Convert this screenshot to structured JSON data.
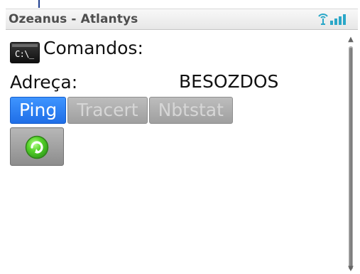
{
  "window": {
    "title": "Ozeanus - Atlantys"
  },
  "status": {
    "signal_icon": "signal-strength-icon"
  },
  "content": {
    "commands_icon": "terminal-icon",
    "commands_icon_text": "C:\\_",
    "commands_label": "Comandos:",
    "address_label": "Adreça:",
    "address_value": "BESOZDOS",
    "buttons": [
      {
        "label": "Ping",
        "state": "active"
      },
      {
        "label": "Tracert",
        "state": "inactive"
      },
      {
        "label": "Nbtstat",
        "state": "inactive"
      }
    ],
    "refresh_icon": "refresh-icon"
  },
  "colors": {
    "active_button": "#1f6ee7",
    "inactive_button": "#9f9f9f",
    "title_text": "#4e4e4e",
    "signal_teal": "#2aa7c8",
    "refresh_green": "#45b923"
  }
}
